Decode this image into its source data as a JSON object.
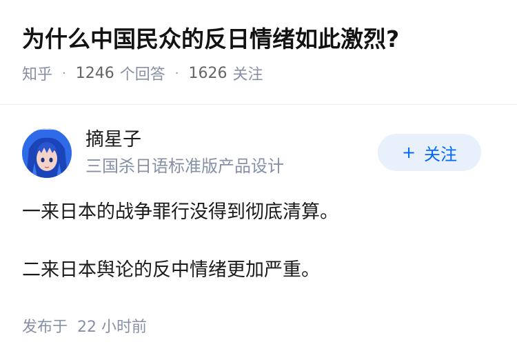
{
  "question": {
    "title": "为什么中国民众的反日情绪如此激烈?",
    "source": "知乎",
    "answer_count": "1246",
    "answer_label": "个回答",
    "follow_count": "1626",
    "follow_label": "关注"
  },
  "answer": {
    "author_name": "摘星子",
    "author_bio": "三国杀日语标准版产品设计",
    "follow_button": "关注",
    "follow_plus": "+",
    "paragraphs": [
      "一来日本的战争罪行没得到彻底清算。",
      "二来日本舆论的反中情绪更加严重。"
    ],
    "published_prefix": "发布于",
    "published_time": "22 小时前"
  },
  "icons": {
    "avatar": "anime-character-avatar"
  },
  "colors": {
    "accent": "#0066ff",
    "follow_bg": "#e8f0fb",
    "meta_text": "#8590a6"
  }
}
